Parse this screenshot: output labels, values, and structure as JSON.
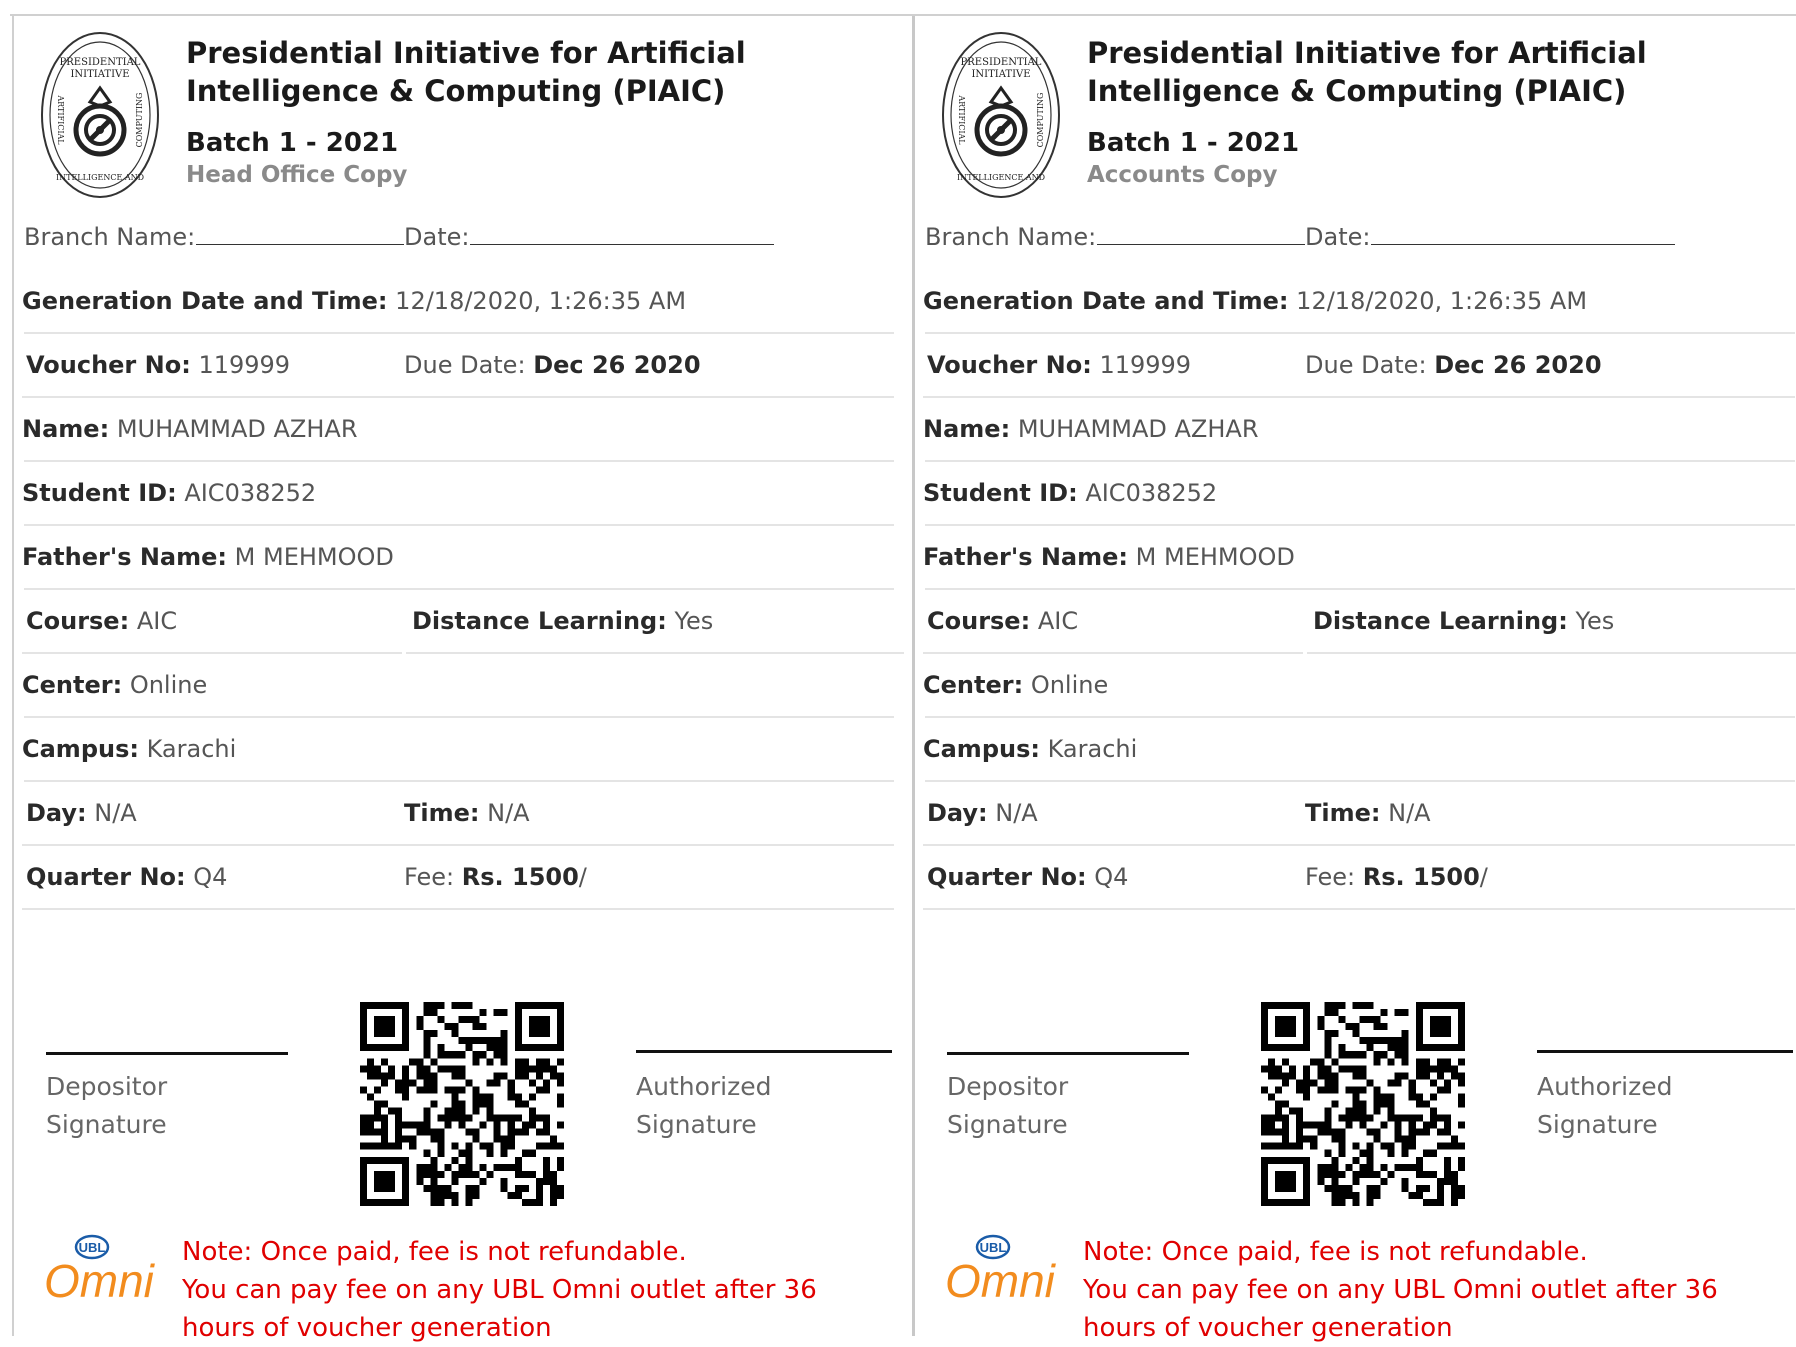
{
  "copies": [
    {
      "org_name": "Presidential Initiative for Artificial Intelligence & Computing (PIAIC)",
      "batch": "Batch 1 - 2021",
      "copy_label": "Head Office Copy",
      "branch_label": "Branch Name:",
      "date_label": "Date:",
      "generation_label": "Generation Date and Time:",
      "generation_value": "12/18/2020, 1:26:35 AM",
      "voucher_label": "Voucher No:",
      "voucher_value": "119999",
      "due_label": "Due Date:",
      "due_value": "Dec 26 2020",
      "name_label": "Name:",
      "name_value": "MUHAMMAD AZHAR",
      "student_id_label": "Student ID:",
      "student_id_value": "AIC038252",
      "father_label": "Father's Name:",
      "father_value": "M MEHMOOD",
      "course_label": "Course:",
      "course_value": "AIC",
      "distance_label": "Distance Learning:",
      "distance_value": "Yes",
      "center_label": "Center:",
      "center_value": "Online",
      "campus_label": "Campus:",
      "campus_value": "Karachi",
      "day_label": "Day:",
      "day_value": "N/A",
      "time_label": "Time:",
      "time_value": "N/A",
      "quarter_label": "Quarter No:",
      "quarter_value": "Q4",
      "fee_label": "Fee:",
      "fee_value": "Rs. 1500",
      "fee_suffix": "/",
      "depositor_line1": "Depositor",
      "depositor_line2": "Signature",
      "authorized_line1": "Authorized",
      "authorized_line2": "Signature",
      "note_line1": "Note: Once paid, fee is not refundable.",
      "note_line2": "You can pay fee on any UBL Omni outlet after 36 hours of voucher generation"
    },
    {
      "org_name": "Presidential Initiative for Artificial Intelligence & Computing (PIAIC)",
      "batch": "Batch 1 - 2021",
      "copy_label": "Accounts Copy",
      "branch_label": "Branch Name:",
      "date_label": "Date:",
      "generation_label": "Generation Date and Time:",
      "generation_value": "12/18/2020, 1:26:35 AM",
      "voucher_label": "Voucher No:",
      "voucher_value": "119999",
      "due_label": "Due Date:",
      "due_value": "Dec 26 2020",
      "name_label": "Name:",
      "name_value": "MUHAMMAD AZHAR",
      "student_id_label": "Student ID:",
      "student_id_value": "AIC038252",
      "father_label": "Father's Name:",
      "father_value": "M MEHMOOD",
      "course_label": "Course:",
      "course_value": "AIC",
      "distance_label": "Distance Learning:",
      "distance_value": "Yes",
      "center_label": "Center:",
      "center_value": "Online",
      "campus_label": "Campus:",
      "campus_value": "Karachi",
      "day_label": "Day:",
      "day_value": "N/A",
      "time_label": "Time:",
      "time_value": "N/A",
      "quarter_label": "Quarter No:",
      "quarter_value": "Q4",
      "fee_label": "Fee:",
      "fee_value": "Rs. 1500",
      "fee_suffix": "/",
      "depositor_line1": "Depositor",
      "depositor_line2": "Signature",
      "authorized_line1": "Authorized",
      "authorized_line2": "Signature",
      "note_line1": "Note: Once paid, fee is not refundable.",
      "note_line2": "You can pay fee on any UBL Omni outlet after 36 hours of voucher generation"
    }
  ],
  "logos": {
    "seal_text_top": "PRESIDENTIAL INITIATIVE",
    "seal_text_ring": "ARTIFICIAL INTELLIGENCE AND COMPUTING",
    "ubl_text": "UBL",
    "omni_text": "Omni"
  },
  "colors": {
    "note_red": "#e00000",
    "omni_orange": "#f28c1e",
    "omni_blue": "#1a5ca8"
  }
}
